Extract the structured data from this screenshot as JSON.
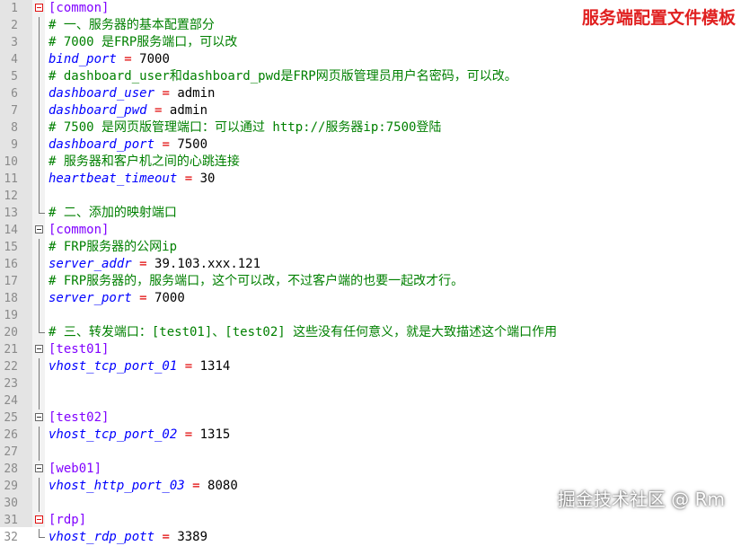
{
  "editor": {
    "lines": [
      {
        "n": "1",
        "type": "section",
        "text": "[common]"
      },
      {
        "n": "2",
        "type": "comment",
        "text": "# 一、服务器的基本配置部分"
      },
      {
        "n": "3",
        "type": "comment",
        "text": "# 7000 是FRP服务端口，可以改"
      },
      {
        "n": "4",
        "type": "kv",
        "key": "bind_port",
        "eq": "=",
        "value": "7000"
      },
      {
        "n": "5",
        "type": "comment",
        "text": "# dashboard_user和dashboard_pwd是FRP网页版管理员用户名密码，可以改。"
      },
      {
        "n": "6",
        "type": "kv",
        "key": "dashboard_user",
        "eq": "=",
        "value": "admin"
      },
      {
        "n": "7",
        "type": "kv",
        "key": "dashboard_pwd",
        "eq": "=",
        "value": "admin"
      },
      {
        "n": "8",
        "type": "comment",
        "text": "# 7500 是网页版管理端口：可以通过 http://服务器ip:7500登陆"
      },
      {
        "n": "9",
        "type": "kv",
        "key": "dashboard_port",
        "eq": "=",
        "value": "7500"
      },
      {
        "n": "10",
        "type": "comment",
        "text": "# 服务器和客户机之间的心跳连接"
      },
      {
        "n": "11",
        "type": "kv",
        "key": "heartbeat_timeout",
        "eq": "=",
        "value": "30"
      },
      {
        "n": "12",
        "type": "blank"
      },
      {
        "n": "13",
        "type": "comment",
        "text": "# 二、添加的映射端口"
      },
      {
        "n": "14",
        "type": "section",
        "text": "[common]"
      },
      {
        "n": "15",
        "type": "comment",
        "text": "# FRP服务器的公网ip"
      },
      {
        "n": "16",
        "type": "kv",
        "key": "server_addr",
        "eq": "=",
        "value": "39.103.xxx.121"
      },
      {
        "n": "17",
        "type": "comment",
        "text": "# FRP服务器的，服务端口，这个可以改，不过客户端的也要一起改才行。"
      },
      {
        "n": "18",
        "type": "kv",
        "key": "server_port",
        "eq": "=",
        "value": "7000"
      },
      {
        "n": "19",
        "type": "blank"
      },
      {
        "n": "20",
        "type": "comment",
        "text": "# 三、转发端口：[test01]、[test02] 这些没有任何意义，就是大致描述这个端口作用"
      },
      {
        "n": "21",
        "type": "section",
        "text": "[test01]"
      },
      {
        "n": "22",
        "type": "kv",
        "key": "vhost_tcp_port_01",
        "eq": "=",
        "value": "1314"
      },
      {
        "n": "23",
        "type": "blank"
      },
      {
        "n": "24",
        "type": "blank"
      },
      {
        "n": "25",
        "type": "section",
        "text": "[test02]"
      },
      {
        "n": "26",
        "type": "kv",
        "key": "vhost_tcp_port_02",
        "eq": "=",
        "value": "1315"
      },
      {
        "n": "27",
        "type": "blank"
      },
      {
        "n": "28",
        "type": "section",
        "text": "[web01]"
      },
      {
        "n": "29",
        "type": "kv",
        "key": "vhost_http_port_03",
        "eq": "=",
        "value": "8080"
      },
      {
        "n": "30",
        "type": "blank"
      },
      {
        "n": "31",
        "type": "section",
        "text": "[rdp]"
      },
      {
        "n": "32",
        "type": "kv",
        "key": "vhost_rdp_pott",
        "eq": "=",
        "value": "3389"
      }
    ]
  },
  "overlay": {
    "title_watermark": "服务端配置文件模板",
    "site_watermark": "掘金技术社区 @ Rm"
  },
  "colors": {
    "section": "#8000ff",
    "comment": "#008000",
    "key": "#0000ff",
    "equals": "#e00000",
    "title_watermark": "#e02020"
  }
}
